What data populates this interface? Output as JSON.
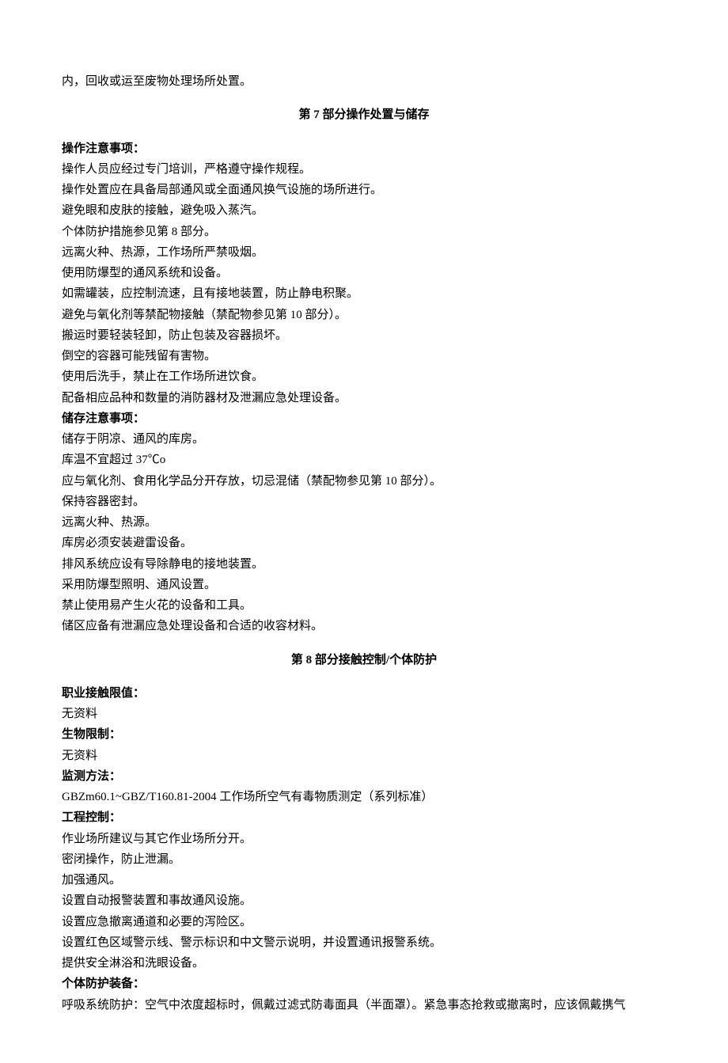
{
  "intro_line": "内，回收或运至废物处理场所处置。",
  "section7": {
    "title": "第 7 部分操作处置与储存",
    "op_label": "操作注意事项：",
    "op_lines": [
      "操作人员应经过专门培训，严格遵守操作规程。",
      "操作处置应在具备局部通风或全面通风换气设施的场所进行。",
      "避免眼和皮肤的接触，避免吸入蒸汽。",
      "个体防护措施参见第 8 部分。",
      "远离火种、热源，工作场所严禁吸烟。",
      "使用防爆型的通风系统和设备。",
      "如需罐装，应控制流速，且有接地装置，防止静电积聚。",
      "避免与氧化剂等禁配物接触（禁配物参见第 10 部分）。",
      "搬运时要轻装轻卸，防止包装及容器损坏。",
      "倒空的容器可能残留有害物。",
      "使用后洗手，禁止在工作场所进饮食。",
      "配备相应品种和数量的消防器材及泄漏应急处理设备。"
    ],
    "storage_label": "储存注意事项：",
    "storage_lines": [
      "储存于阴凉、通风的库房。",
      "库温不宜超过 37℃o",
      "应与氧化剂、食用化学品分开存放，切忌混储（禁配物参见第 10 部分）。",
      "保持容器密封。",
      "远离火种、热源。",
      "库房必须安装避雷设备。",
      "排风系统应设有导除静电的接地装置。",
      "采用防爆型照明、通风设置。",
      "禁止使用易产生火花的设备和工具。",
      "储区应备有泄漏应急处理设备和合适的收容材料。"
    ]
  },
  "section8": {
    "title": "第 8 部分接触控制/个体防护",
    "exposure_label": "职业接触限值：",
    "exposure_value": "无资料",
    "bio_label": "生物限制：",
    "bio_value": "无资料",
    "monitor_label": "监测方法：",
    "monitor_value": "GBZm60.1~GBZ/T160.81-2004 工作场所空气有毒物质测定（系列标准）",
    "eng_label": "工程控制：",
    "eng_lines": [
      "作业场所建议与其它作业场所分开。",
      "密闭操作，防止泄漏。",
      "加强通风。",
      "设置自动报警装置和事故通风设施。",
      "设置应急撤离通道和必要的泻险区。",
      "设置红色区域警示线、警示标识和中文警示说明，并设置通讯报警系统。",
      "提供安全淋浴和洗眼设备。"
    ],
    "ppe_label": "个体防护装备：",
    "ppe_line": "呼吸系统防护：空气中浓度超标时，佩戴过滤式防毒面具（半面罩）。紧急事态抢救或撤离时，应该佩戴携气"
  }
}
